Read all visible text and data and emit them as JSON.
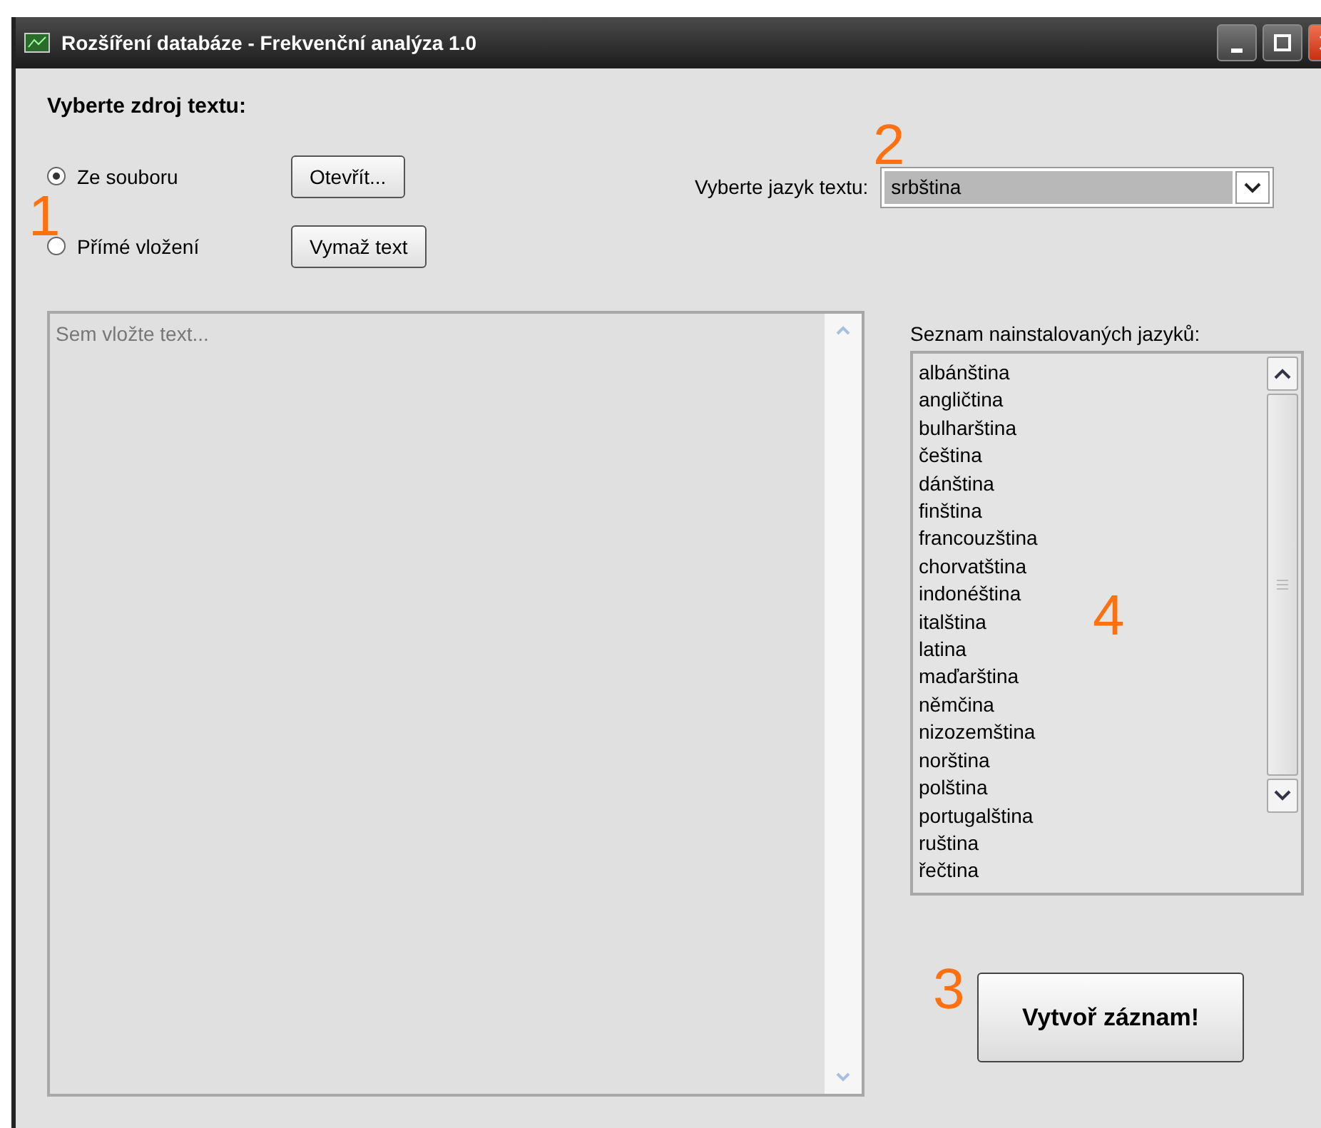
{
  "window": {
    "title": "Rozšíření databáze - Frekvenční analýza 1.0"
  },
  "source": {
    "heading": "Vyberte zdroj textu:",
    "options": [
      {
        "label": "Ze souboru",
        "selected": true,
        "button": "Otevřít..."
      },
      {
        "label": "Přímé vložení",
        "selected": false,
        "button": "Vymaž text"
      }
    ]
  },
  "language": {
    "label": "Vyberte jazyk textu:",
    "value": "srbština"
  },
  "text_area": {
    "placeholder": "Sem vložte text...",
    "disabled": true
  },
  "installed": {
    "label": "Seznam nainstalovaných jazyků:",
    "items": [
      "albánština",
      "angličtina",
      "bulharština",
      "čeština",
      "dánština",
      "finština",
      "francouzština",
      "chorvatština",
      "indonéština",
      "italština",
      "latina",
      "maďarština",
      "němčina",
      "nizozemština",
      "norština",
      "polština",
      "portugalština",
      "ruština",
      "řečtina"
    ]
  },
  "create_button": "Vytvoř záznam!",
  "callouts": [
    "1",
    "2",
    "3",
    "4"
  ]
}
